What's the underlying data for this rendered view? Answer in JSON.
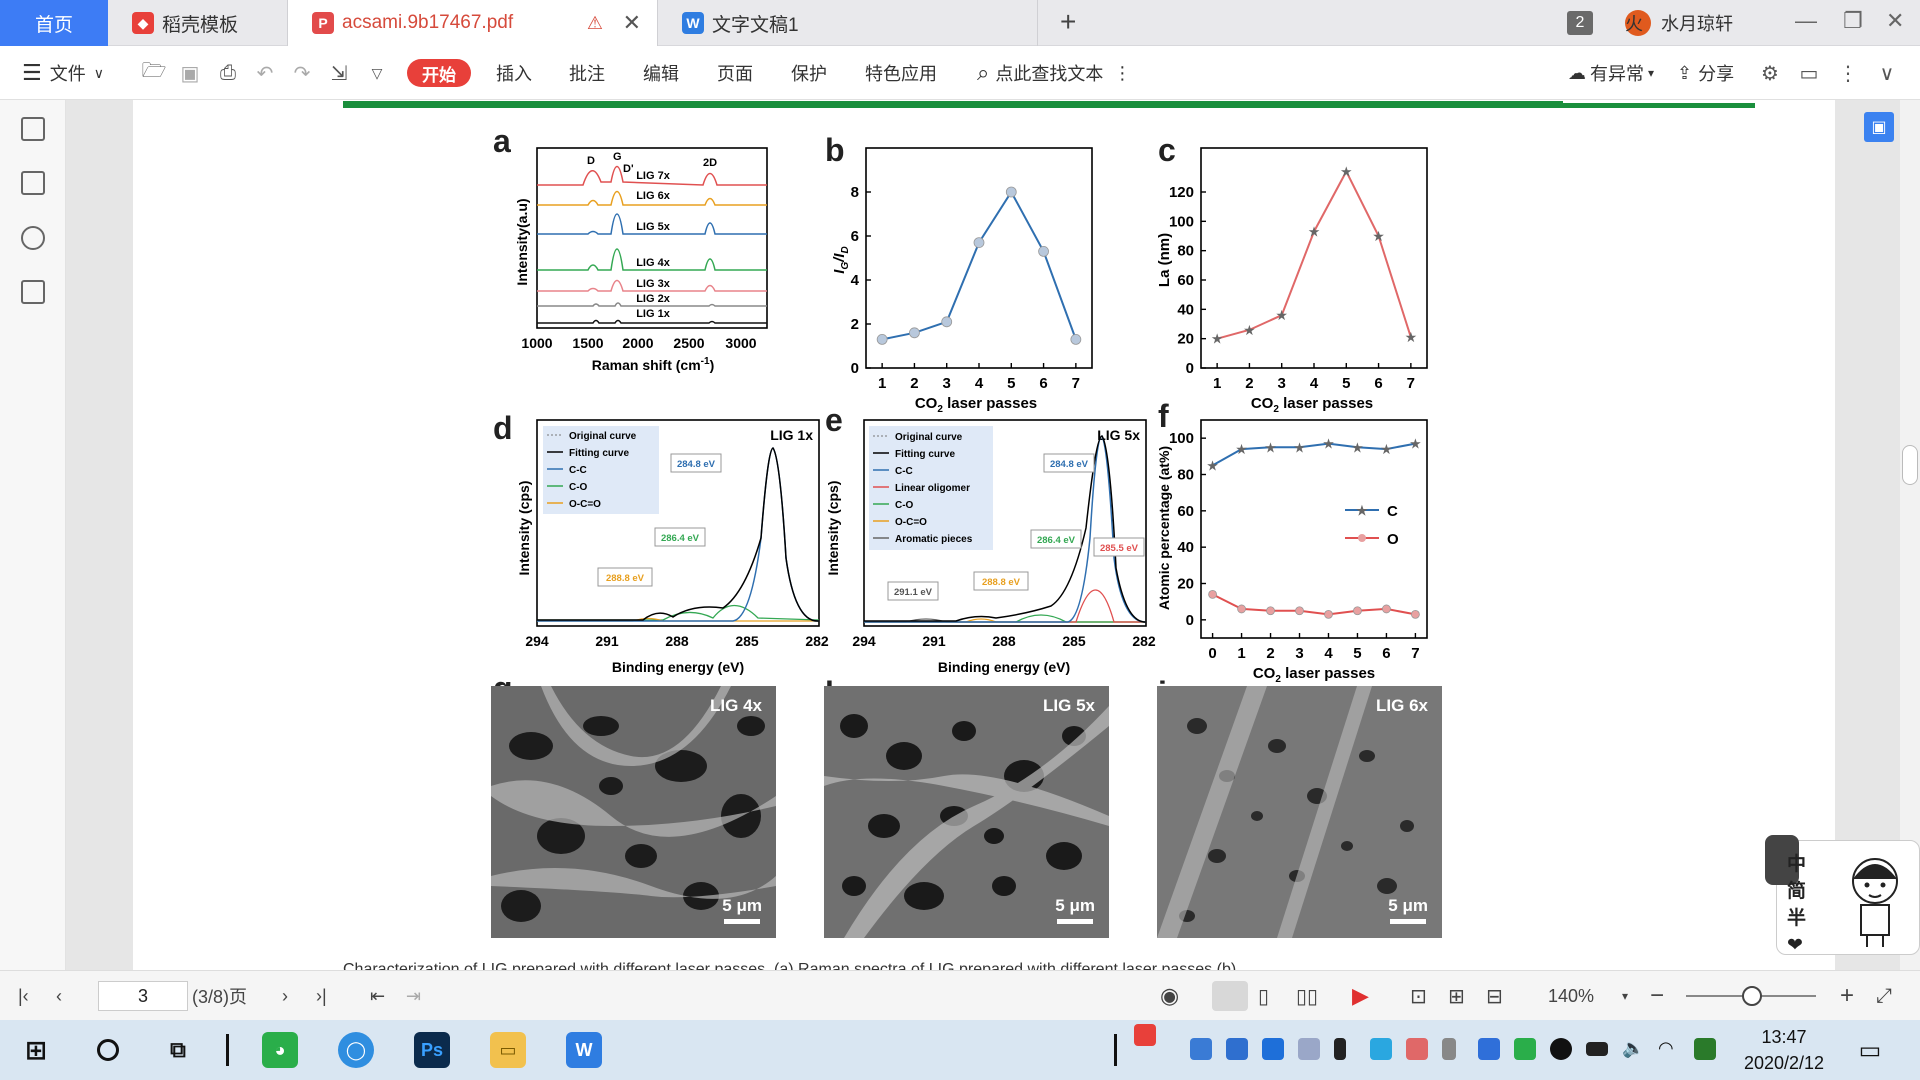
{
  "tabs": {
    "home": "首页",
    "template": "稻壳模板",
    "pdf": "acsami.9b17467.pdf",
    "doc": "文字文稿1",
    "window_count": "2",
    "user": "水月琼轩"
  },
  "toolbar": {
    "file": "文件",
    "start": "开始",
    "insert": "插入",
    "annotate": "批注",
    "edit": "编辑",
    "page": "页面",
    "protect": "保护",
    "special": "特色应用",
    "search": "点此查找文本",
    "anomaly": "有异常",
    "share": "分享"
  },
  "figure": {
    "panels": [
      "a",
      "b",
      "c",
      "d",
      "e",
      "f",
      "g",
      "h",
      "i"
    ],
    "a": {
      "peaks": {
        "d": "D",
        "g": "G",
        "dp": "D'",
        "twod": "2D"
      },
      "series": [
        "LIG 7x",
        "LIG 6x",
        "LIG 5x",
        "LIG 4x",
        "LIG 3x",
        "LIG 2x",
        "LIG 1x"
      ],
      "ylabel": "Intensity(a.u)",
      "xlabel_main": "Raman shift (cm",
      "xlabel_sup": "-1",
      "xlabel_tail": ")",
      "xticks": [
        "1000",
        "1500",
        "2000",
        "2500",
        "3000"
      ]
    },
    "b": {
      "ylabel_i1": "I",
      "ylabel_sub1": "G",
      "ylabel_slash": "/",
      "ylabel_i2": "I",
      "ylabel_sub2": "D",
      "yticks": [
        "0",
        "2",
        "4",
        "6",
        "8"
      ],
      "xticks": [
        "1",
        "2",
        "3",
        "4",
        "5",
        "6",
        "7"
      ],
      "xlabel_a": "CO",
      "xlabel_sub": "2",
      "xlabel_b": " laser passes"
    },
    "c": {
      "ylabel": "La (nm)",
      "yticks": [
        "0",
        "20",
        "40",
        "60",
        "80",
        "100",
        "120"
      ],
      "xticks": [
        "1",
        "2",
        "3",
        "4",
        "5",
        "6",
        "7"
      ],
      "xlabel_a": "CO",
      "xlabel_sub": "2",
      "xlabel_b": " laser passes"
    },
    "d": {
      "tag": "LIG 1x",
      "legend": [
        "Original curve",
        "Fitting curve",
        "C-C",
        "C-O",
        "O-C=O"
      ],
      "labels": [
        "284.8 eV",
        "286.4 eV",
        "288.8 eV"
      ],
      "ylabel": "Intensity (cps)",
      "xlabel": "Binding energy (eV)",
      "xticks": [
        "294",
        "291",
        "288",
        "285",
        "282"
      ]
    },
    "e": {
      "tag": "LIG 5x",
      "legend": [
        "Original curve",
        "Fitting curve",
        "C-C",
        "Linear oligomer",
        "C-O",
        "O-C=O",
        "Aromatic pieces"
      ],
      "labels": [
        "284.8 eV",
        "286.4 eV",
        "288.8 eV",
        "291.1 eV",
        "285.5 eV"
      ],
      "ylabel": "Intensity (cps)",
      "xlabel": "Binding energy (eV)",
      "xticks": [
        "294",
        "291",
        "288",
        "285",
        "282"
      ]
    },
    "f": {
      "ylabel": "Atomic percentage (at%)",
      "yticks": [
        "0",
        "20",
        "40",
        "60",
        "80",
        "100"
      ],
      "xticks": [
        "0",
        "1",
        "2",
        "3",
        "4",
        "5",
        "6",
        "7"
      ],
      "legend": [
        "C",
        "O"
      ],
      "xlabel_a": "CO",
      "xlabel_sub": "2",
      "xlabel_b": " laser passes"
    },
    "g": {
      "tag": "LIG 4x",
      "scale": "5 μm"
    },
    "h": {
      "tag": "LIG 5x",
      "scale": "5 μm"
    },
    "i": {
      "tag": "LIG 6x",
      "scale": "5 μm"
    }
  },
  "chart_data": [
    {
      "type": "line",
      "panel": "b",
      "x": [
        1,
        2,
        3,
        4,
        5,
        6,
        7
      ],
      "series": [
        {
          "values": [
            1.3,
            1.6,
            2.1,
            5.7,
            8.0,
            5.3,
            1.3
          ]
        }
      ],
      "ylim": [
        0,
        10
      ],
      "xlim": [
        0.5,
        7.5
      ]
    },
    {
      "type": "line",
      "panel": "c",
      "x": [
        1,
        2,
        3,
        4,
        5,
        6,
        7
      ],
      "series": [
        {
          "values": [
            20,
            26,
            36,
            93,
            134,
            90,
            21
          ]
        }
      ],
      "ylim": [
        0,
        150
      ],
      "xlim": [
        0.5,
        7.5
      ]
    },
    {
      "type": "line",
      "panel": "f",
      "x": [
        0,
        1,
        2,
        3,
        4,
        5,
        6,
        7
      ],
      "series": [
        {
          "name": "C",
          "values": [
            85,
            94,
            95,
            95,
            97,
            95,
            94,
            97
          ]
        },
        {
          "name": "O",
          "values": [
            14,
            6,
            5,
            5,
            3,
            5,
            6,
            3
          ]
        }
      ],
      "ylim": [
        -10,
        110
      ],
      "xlim": [
        -0.4,
        7.4
      ]
    }
  ],
  "caption_fragment": "Characterization of LIG prepared with different laser passes. (a) Raman spectra of LIG prepared with different laser passes (b)",
  "statusbar": {
    "page_value": "3",
    "page_total": "(3/8)页",
    "zoom": "140%"
  },
  "ime": {
    "chars": [
      "中",
      "简",
      "半"
    ]
  },
  "clock": {
    "time": "13:47",
    "date": "2020/2/12"
  },
  "taskbar": {
    "ps": "Ps",
    "wps": "W"
  }
}
